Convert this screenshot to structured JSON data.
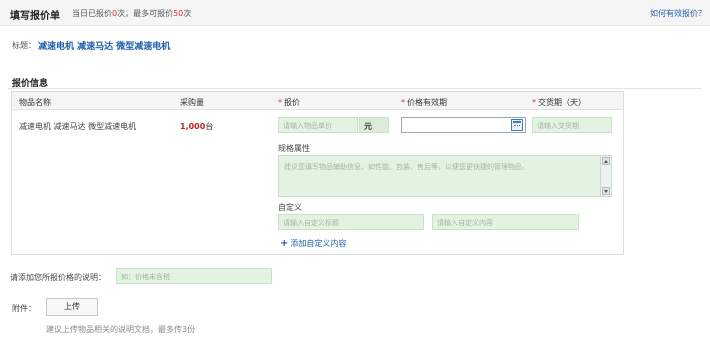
{
  "header": {
    "title": "填写报价单",
    "sub_prefix": "当日已报价",
    "today_count": "0",
    "sub_mid": "次，最多可报价",
    "max_count": "50",
    "sub_suffix": "次",
    "help_link": "如何有效报价？"
  },
  "subject": {
    "label": "标题：",
    "value": "减速电机  减速马达  微型减速电机"
  },
  "quote_section": {
    "title": "报价信息",
    "columns": {
      "item_name": "物品名称",
      "purchase_qty": "采购量",
      "price": "报价",
      "price_validity": "价格有效期",
      "delivery": "交货期（天）"
    },
    "required_mark": "*",
    "row": {
      "item_name": "减速电机  减速马达  微型减速电机",
      "qty_value": "1,000",
      "qty_unit": "台"
    },
    "price_placeholder": "请输入物品单价",
    "price_unit": "元",
    "date_value": "",
    "delivery_placeholder": "请输入交货期",
    "spec_label": "规格属性",
    "spec_placeholder": "建议您填写物品辅助信息，如性能、包装、售后等，以便您更快捷的管理物品。",
    "custom_label": "自定义",
    "custom_title_placeholder": "请输入自定义标题",
    "custom_content_placeholder": "请输入自定义内容",
    "add_custom": "添加自定义内容",
    "add_icon": "+"
  },
  "note": {
    "label": "请添加您所报价格的说明：",
    "placeholder": "如：价格未含税"
  },
  "attachment": {
    "label": "附件：",
    "upload_button": "上传",
    "hint": "建议上传物品相关的说明文档，最多传3份"
  },
  "colors": {
    "accent_blue": "#1e5fad",
    "required_red": "#e0322d",
    "input_green": "#e3f3e1"
  },
  "icons": {
    "calendar": "calendar-icon",
    "add": "plus-icon",
    "scroll_up": "scroll-up-arrow-icon",
    "scroll_down": "scroll-down-arrow-icon"
  }
}
